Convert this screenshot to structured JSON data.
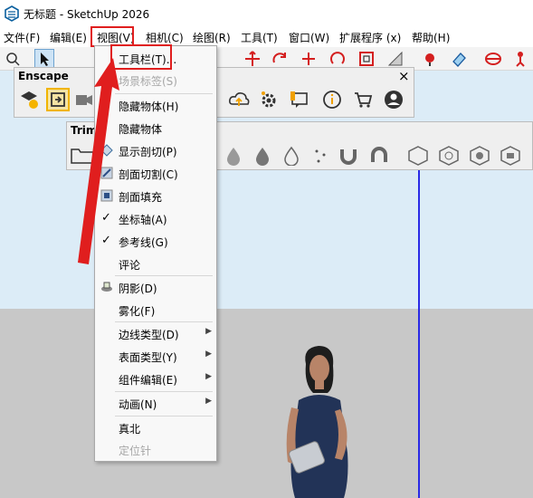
{
  "window": {
    "title": "无标题 - SketchUp 2026"
  },
  "menubar": {
    "items": [
      "文件(F)",
      "编辑(E)",
      "视图(V)",
      "相机(C)",
      "绘图(R)",
      "工具(T)",
      "窗口(W)",
      "扩展程序 (x)",
      "帮助(H)"
    ]
  },
  "enscape_panel": {
    "title": "Enscape",
    "close": "×"
  },
  "trimble_panel": {
    "title": "Trim"
  },
  "view_menu": {
    "toolbars": "工具栏(T)...",
    "scene_tabs": "场景标签(S)",
    "hidden_geometry": "隐藏物体(H)",
    "hidden_objects": "隐藏物体",
    "section_planes": "显示剖切(P)",
    "section_cuts": "剖面切割(C)",
    "section_fill": "剖面填充",
    "axes": "坐标轴(A)",
    "guides": "参考线(G)",
    "comments": "评论",
    "shadows": "阴影(D)",
    "fog": "雾化(F)",
    "edge_style": "边线类型(D)",
    "face_style": "表面类型(Y)",
    "component_edit": "组件编辑(E)",
    "animation": "动画(N)",
    "true_north": "真北",
    "locate": "定位针"
  },
  "colors": {
    "highlight_red": "#e01e1e",
    "sky": "#dcecf7",
    "ground": "#c8c8c8",
    "axis_blue": "#2a2ae6"
  }
}
